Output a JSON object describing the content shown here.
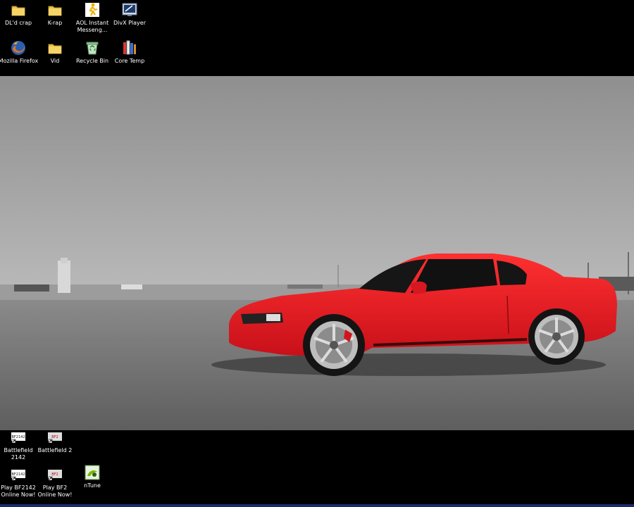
{
  "desktop": {
    "background": "#000000",
    "top_icons": [
      {
        "label": "DL'd crap",
        "icon": "folder-icon"
      },
      {
        "label": "K-rap",
        "icon": "folder-icon"
      },
      {
        "label": "AOL Instant\nMesseng...",
        "icon": "aim-running-man-icon"
      },
      {
        "label": "DivX Player",
        "icon": "divx-player-icon"
      },
      {
        "label": "Mozilla Firefox",
        "icon": "firefox-icon"
      },
      {
        "label": "Vid",
        "icon": "folder-icon"
      },
      {
        "label": "Recycle Bin",
        "icon": "recycle-bin-icon"
      },
      {
        "label": "Core Temp",
        "icon": "core-temp-icon"
      }
    ],
    "bottom_icons": [
      {
        "label": "Battlefield\n2142",
        "icon": "battlefield-2142-shortcut-icon"
      },
      {
        "label": "Battlefield 2",
        "icon": "battlefield-2-shortcut-icon"
      },
      {
        "label": "Play BF2142\nOnline Now!",
        "icon": "play-bf2142-shortcut-icon"
      },
      {
        "label": "Play BF2\nOnline Now!",
        "icon": "play-bf2-shortcut-icon"
      },
      {
        "label": "nTune",
        "icon": "ntune-icon"
      }
    ],
    "wallpaper": {
      "description_icon": "red-mustang-wallpaper",
      "car_color": "#e0161a",
      "sky_color": "#a9a9a9",
      "ground_color": "#6e6e6e"
    }
  }
}
